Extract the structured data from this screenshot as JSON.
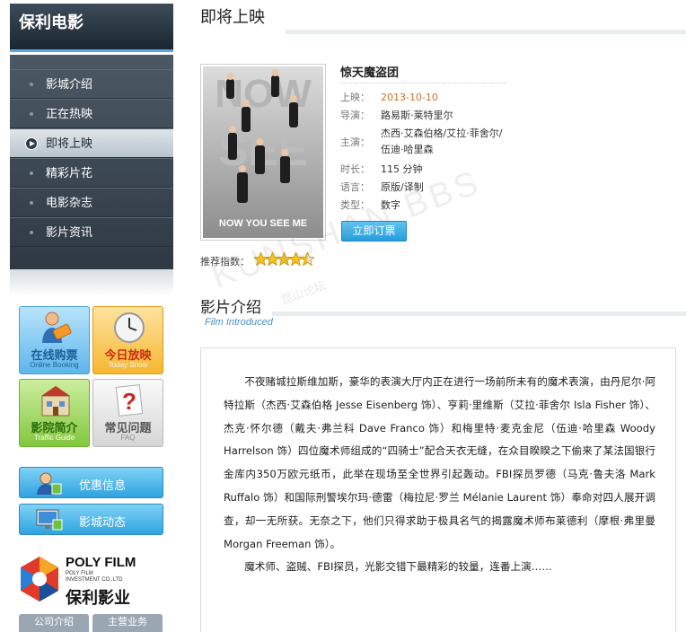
{
  "sidebar": {
    "brand": "保利电影",
    "nav": [
      {
        "label": "影城介绍",
        "active": false
      },
      {
        "label": "正在热映",
        "active": false
      },
      {
        "label": "即将上映",
        "active": true
      },
      {
        "label": "精彩片花",
        "active": false
      },
      {
        "label": "电影杂志",
        "active": false
      },
      {
        "label": "影片资讯",
        "active": false
      }
    ],
    "tiles": [
      {
        "title": "在线购票",
        "sub": "Online Booking",
        "icon": "ticket-tag-icon"
      },
      {
        "title": "今日放映",
        "sub": "Today Show",
        "icon": "clock-icon"
      },
      {
        "title": "影院简介",
        "sub": "Traffic Guide",
        "icon": "cinema-building-icon"
      },
      {
        "title": "常见问题",
        "sub": "FAQ",
        "icon": "question-icon"
      }
    ],
    "wide_buttons": [
      {
        "label": "优惠信息",
        "icon": "user-icon"
      },
      {
        "label": "影城动态",
        "icon": "monitor-icon"
      }
    ],
    "logo": {
      "en": "POLY FILM",
      "en_sub": "POLY FILM\nINVESTMENT CO.,LTD",
      "cn": "保利影业"
    },
    "footer_tabs": [
      "公司介绍",
      "主营业务"
    ]
  },
  "main": {
    "section_title": "即将上映",
    "movie": {
      "title": "惊天魔盗团",
      "poster_text": "NOW YOU SEE ME",
      "fields": [
        {
          "key": "上映：",
          "value": "2013-10-10"
        },
        {
          "key": "导演：",
          "value": "路易斯·莱特里尔"
        },
        {
          "key": "主演：",
          "value": "杰西·艾森伯格/艾拉·菲舍尔/伍迪·哈里森"
        },
        {
          "key": "时长：",
          "value": "115 分钟"
        },
        {
          "key": "语言：",
          "value": "原版/译制"
        },
        {
          "key": "类型：",
          "value": "数字"
        }
      ],
      "book_label": "立即订票",
      "rating_label": "推荐指数：",
      "rating": 4.5,
      "rating_max": 5
    },
    "intro_title": "影片介绍",
    "intro_sub": "Film Introduced",
    "synopsis": [
      "不夜赌城拉斯维加斯，豪华的表演大厅内正在进行一场前所未有的魔术表演，由丹尼尔·阿特拉斯（杰西·艾森伯格 Jesse Eisenberg 饰）、亨莉·里维斯（艾拉·菲舍尔 Isla Fisher 饰）、杰克·怀尔德（戴夫·弗兰科 Dave Franco 饰）和梅里特·麦克金尼（伍迪·哈里森 Woody Harrelson 饰）四位魔术师组成的“四骑士”配合天衣无缝，在众目睽睽之下偷来了某法国银行金库内350万欧元纸币，此举在现场至全世界引起轰动。FBI探员罗德（马克·鲁夫洛 Mark Ruffalo 饰）和国际刑警埃尔玛·德雷（梅拉尼·罗兰 Mélanie Laurent 饰）奉命对四人展开调查，却一无所获。无奈之下，他们只得求助于极具名气的揭露魔术师布莱德利（摩根·弗里曼 Morgan Freeman 饰）。",
      "魔术师、盗贼、FBI探员，光影交错下最精彩的较量，连番上演……"
    ],
    "watermark": "KUNSHAN BBS",
    "watermark_cn": "昆山论坛"
  }
}
